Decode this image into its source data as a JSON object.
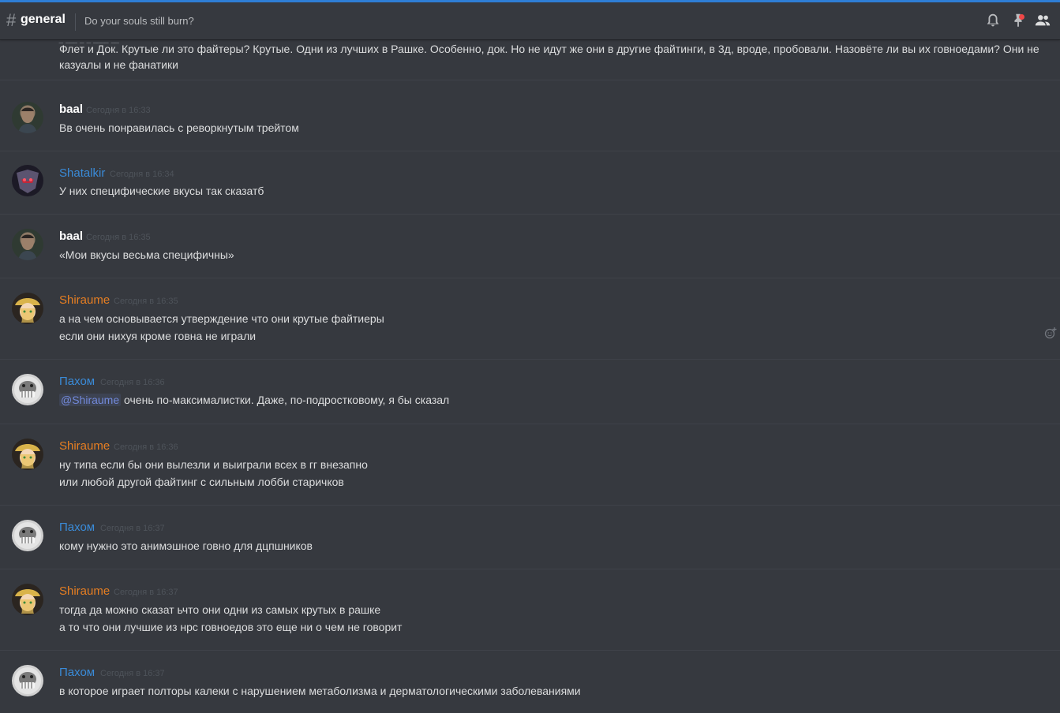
{
  "header": {
    "channel_name": "general",
    "hash_symbol": "#",
    "topic": "Do your souls still burn?",
    "icons": [
      "bell-icon",
      "pin-icon",
      "members-icon"
    ],
    "pin_notification": true
  },
  "colors": {
    "background": "#36393f",
    "accent": "#2e7ed6",
    "baal": "#ffffff",
    "shatalkir": "#3a8bd8",
    "shiraume": "#e67e22",
    "pahom": "#3a8bd8",
    "timestamp": "#4e535a",
    "mention": "#7289da"
  },
  "messages": {
    "partial": {
      "line1": "Флет и Док. Крутые ли это файтеры? Крутые. Одни из лучших в Рашке. Особенно, док. Но не идут же они в другие файтинги, в 3д, вроде, пробовали. Назовёте ли вы их говноедами? Они не",
      "line2": "казуалы и не фанатики"
    },
    "g1": {
      "author": "baal",
      "time": "Сегодня в 16:33",
      "lines": [
        "Вв очень понравилась с реворкнутым трейтом"
      ]
    },
    "g2": {
      "author": "Shatalkir",
      "time": "Сегодня в 16:34",
      "lines": [
        "У них специфические вкусы так сказатб"
      ]
    },
    "g3": {
      "author": "baal",
      "time": "Сегодня в 16:35",
      "lines": [
        "«Мои вкусы весьма специфичны»"
      ]
    },
    "g4": {
      "author": "Shiraume",
      "time": "Сегодня в 16:35",
      "lines": [
        "а на чем основывается утверждение что они крутые файтиеры",
        "если они нихуя кроме говна не играли"
      ]
    },
    "g5": {
      "author": "Пахом",
      "time": "Сегодня в 16:36",
      "mention": "@Shiraume",
      "lines": [
        "очень по-максималистки. Даже, по-подростковому, я бы сказал"
      ]
    },
    "g6": {
      "author": "Shiraume",
      "time": "Сегодня в 16:36",
      "lines": [
        "ну типа если бы они вылезли и выиграли всех в гг внезапно",
        "или любой другой файтинг с сильным лобби старичков"
      ]
    },
    "g7": {
      "author": "Пахом",
      "time": "Сегодня в 16:37",
      "lines": [
        "кому нужно это анимэшное говно для дцпшников"
      ]
    },
    "g8": {
      "author": "Shiraume",
      "time": "Сегодня в 16:37",
      "lines": [
        "тогда да можно сказат ьчто они одни из самых крутых в рашке",
        "а то что они лучшие из нрс говноедов это еще ни о чем не говорит"
      ]
    },
    "g9": {
      "author": "Пахом",
      "time": "Сегодня в 16:37",
      "lines": [
        "в которое играет полторы калеки с нарушением метаболизма и дерматологическими заболеваниями"
      ]
    }
  }
}
